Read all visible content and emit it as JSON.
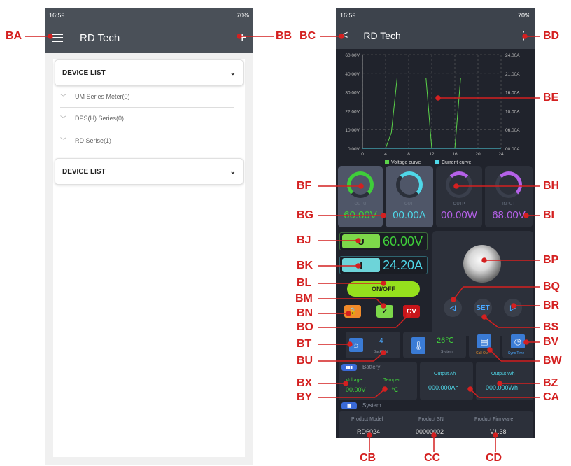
{
  "callouts": {
    "BA": "BA",
    "BB": "BB",
    "BC": "BC",
    "BD": "BD",
    "BE": "BE",
    "BF": "BF",
    "BG": "BG",
    "BH": "BH",
    "BI": "BI",
    "BJ": "BJ",
    "BK": "BK",
    "BL": "BL",
    "BM": "BM",
    "BN": "BN",
    "BO": "BO",
    "BP": "BP",
    "BQ": "BQ",
    "BR": "BR",
    "BS": "BS",
    "BT": "BT",
    "BU": "BU",
    "BV": "BV",
    "BW": "BW",
    "BX": "BX",
    "BY": "BY",
    "BZ": "BZ",
    "CA": "CA",
    "CB": "CB",
    "CC": "CC",
    "CD": "CD"
  },
  "left": {
    "time": "16:59",
    "status": "70%",
    "title": "RD Tech",
    "add": "+",
    "device_list": "DEVICE LIST",
    "device_list2": "DEVICE LIST",
    "series": [
      {
        "label": "UM Series Meter(0)"
      },
      {
        "label": "DPS(H) Series(0)"
      },
      {
        "label": "RD Serise(1)"
      }
    ]
  },
  "right": {
    "time": "16:59",
    "status": "70%",
    "title": "RD Tech",
    "back": "<",
    "more": "⋮",
    "legend": {
      "voltage": "Voltage curve",
      "current": "Current curve"
    },
    "meters": [
      {
        "label": "OUTU",
        "value": "60.00V",
        "color": "#3fce3a"
      },
      {
        "label": "OUTI",
        "value": "00.00A",
        "color": "#4fd7e8"
      },
      {
        "label": "OUTP",
        "value": "00.00W",
        "color": "#b561e8"
      },
      {
        "label": "INPUT",
        "value": "68.00V",
        "color": "#b561e8"
      }
    ],
    "uset": {
      "icon": "U",
      "value": "60.00V"
    },
    "iset": {
      "icon": "I",
      "value": "24.20A"
    },
    "onoff": "ON/OFF",
    "cv": "CV",
    "backlight": {
      "value": "4",
      "label": "Backlight"
    },
    "system_temp": {
      "value": "26℃",
      "label": "System"
    },
    "callout_label": "Call Out",
    "sync_label": "Sync Time",
    "battery": {
      "title": "Battery",
      "voltage_label": "Voltage",
      "voltage": "00.00V",
      "temper_label": "Temper",
      "temper": "-℃",
      "ah_label": "Output Ah",
      "ah": "000.000Ah",
      "wh_label": "Output Wh",
      "wh": "000.000Wh"
    },
    "system": {
      "title": "System",
      "model_label": "Product Model",
      "model": "RD6024",
      "sn_label": "Product SN",
      "sn": "00000002",
      "fw_label": "Product Firmware",
      "fw": "V1.38"
    },
    "set": "SET"
  },
  "chart_data": {
    "type": "line",
    "x": [
      0,
      1,
      2,
      3,
      4,
      5,
      6,
      7,
      8,
      9,
      10,
      11,
      12,
      13,
      14,
      15,
      16,
      17,
      18,
      19,
      20,
      21,
      22,
      23,
      24
    ],
    "series": [
      {
        "name": "Voltage curve",
        "values": [
          0,
          0,
          0,
          0,
          0,
          10,
          45,
          45,
          45,
          45,
          45,
          45,
          0,
          0,
          0,
          0,
          0,
          45,
          45,
          45,
          45,
          45,
          45,
          45,
          45
        ]
      },
      {
        "name": "Current curve",
        "values": [
          0,
          0,
          0,
          0,
          0,
          0,
          0,
          0,
          0,
          0,
          0,
          0,
          0,
          0,
          0,
          0,
          0,
          0,
          0,
          0,
          0,
          0,
          0,
          0,
          0
        ]
      }
    ],
    "y_left_ticks": [
      "60.00V",
      "40.00V",
      "30.00V",
      "22.00V",
      "10.00V",
      "0.00V"
    ],
    "y_right_ticks": [
      "24.00A",
      "21.00A",
      "16.00A",
      "10.00A",
      "06.00A",
      "00.00A"
    ],
    "x_ticks": [
      "0",
      "4",
      "8",
      "12",
      "16",
      "20",
      "24"
    ],
    "ylim": [
      0,
      60
    ],
    "xlim": [
      0,
      24
    ],
    "colors": {
      "voltage": "#5bd34a",
      "current": "#4fd7e8"
    }
  }
}
